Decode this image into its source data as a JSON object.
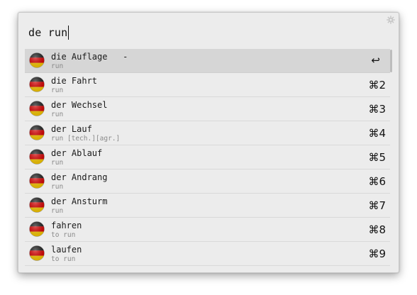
{
  "search": {
    "query": "de run"
  },
  "results": [
    {
      "word": "die Auflage   -",
      "sub": "run",
      "shortcut": "↩",
      "selected": true
    },
    {
      "word": "die Fahrt",
      "sub": "run",
      "shortcut": "⌘2"
    },
    {
      "word": "der Wechsel",
      "sub": "run",
      "shortcut": "⌘3"
    },
    {
      "word": "der Lauf",
      "sub": "run [tech.][agr.]",
      "shortcut": "⌘4"
    },
    {
      "word": "der Ablauf",
      "sub": "run",
      "shortcut": "⌘5"
    },
    {
      "word": "der Andrang",
      "sub": "run",
      "shortcut": "⌘6"
    },
    {
      "word": "der Ansturm",
      "sub": "run",
      "shortcut": "⌘7"
    },
    {
      "word": "fahren",
      "sub": "to run",
      "shortcut": "⌘8"
    },
    {
      "word": "laufen",
      "sub": "to run",
      "shortcut": "⌘9"
    }
  ],
  "icons": {
    "flag": "german-flag-icon",
    "settings": "gear-icon",
    "return": "return-icon"
  },
  "colors": {
    "flag_black": "#1a1a1a",
    "flag_red": "#dd0000",
    "flag_gold": "#ffce00"
  }
}
